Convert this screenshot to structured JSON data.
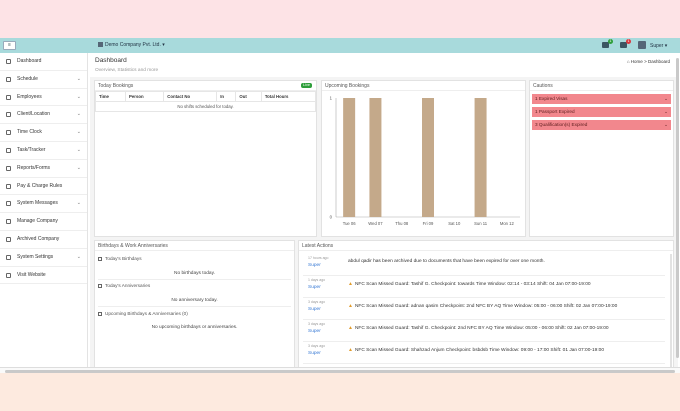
{
  "navbar": {
    "menu_label": "≡",
    "company": "Demo Company Pvt. Ltd.",
    "notif_count_1": "1",
    "notif_count_2": "1",
    "user": "Super"
  },
  "sidebar": {
    "items": [
      {
        "label": "Dashboard",
        "icon": "home-icon",
        "chevron": false
      },
      {
        "label": "Schedule",
        "icon": "calendar-icon",
        "chevron": true
      },
      {
        "label": "Employees",
        "icon": "users-icon",
        "chevron": true
      },
      {
        "label": "Client/Location",
        "icon": "location-icon",
        "chevron": true
      },
      {
        "label": "Time Clock",
        "icon": "clock-icon",
        "chevron": true
      },
      {
        "label": "Task/Tracker",
        "icon": "map-pin-icon",
        "chevron": true
      },
      {
        "label": "Reports/Forms",
        "icon": "file-icon",
        "chevron": true
      },
      {
        "label": "Pay & Charge Rules",
        "icon": "dollar-icon",
        "chevron": false
      },
      {
        "label": "System Messages",
        "icon": "envelope-icon",
        "chevron": true
      },
      {
        "label": "Manage Company",
        "icon": "building-icon",
        "chevron": false
      },
      {
        "label": "Archived Company",
        "icon": "archive-icon",
        "chevron": false
      },
      {
        "label": "System Settings",
        "icon": "gear-icon",
        "chevron": true
      },
      {
        "label": "Visit Website",
        "icon": "globe-icon",
        "chevron": false
      }
    ]
  },
  "page": {
    "title": "Dashboard",
    "subtitle": "Overview, Statistics and more",
    "breadcrumb_home": "Home",
    "breadcrumb_sep": ">",
    "breadcrumb_current": "Dashboard"
  },
  "today_bookings": {
    "title": "Today Bookings",
    "live": "Live",
    "columns": [
      "Time",
      "Person",
      "Contact No",
      "In",
      "Out",
      "Total Hours"
    ],
    "empty": "No shifts scheduled for today."
  },
  "upcoming": {
    "title": "Upcoming Bookings"
  },
  "chart_data": {
    "type": "bar",
    "categories": [
      "Tue 06",
      "Wed 07",
      "Thu 08",
      "Fri 09",
      "Sat 10",
      "Sun 11",
      "Mon 12"
    ],
    "values": [
      1,
      1,
      0,
      1,
      0,
      1,
      0
    ],
    "ylim": [
      0,
      1
    ],
    "yticks": [
      "0",
      "1"
    ],
    "bar_color": "#c4a98a",
    "grid": false,
    "legend": "none"
  },
  "cautions": {
    "title": "Cautions",
    "items": [
      "1 Expired Visas",
      "1 Passport Expired",
      "3 Qualification(s) Expired"
    ],
    "color": "#f2878d"
  },
  "birthdays": {
    "title": "Birthdays & Work Anniversaries",
    "today_birthdays": "Today's Birthdays",
    "no_birthdays": "No birthdays today.",
    "today_anniv": "Today's Anniversaries",
    "no_anniv": "No anniversary today.",
    "upcoming": "Upcoming Birthdays & Anniversaries (0)",
    "no_upcoming": "No upcoming birthdays or anniversaries."
  },
  "latest_actions": {
    "title": "Latest Actions",
    "items": [
      {
        "time": "17 hours ago",
        "user": "Super",
        "text": "abdul qadir has been archived due to documents that have been expired for over one month.",
        "warn": false
      },
      {
        "time": "1 days ago",
        "user": "Super",
        "text": "NFC Scan Missed Guard: Tashif G. Checkpoint: towards Time Window: 02:14 - 03:14 Shift: 04 Jan 07:00-19:00",
        "warn": true
      },
      {
        "time": "3 days ago",
        "user": "Super",
        "text": "NFC Scan Missed Guard: adnan qasim Checkpoint: 2nd NFC BY AQ Time Window: 05:00 - 06:00 Shift: 02 Jan 07:00-19:00",
        "warn": true
      },
      {
        "time": "3 days ago",
        "user": "Super",
        "text": "NFC Scan Missed Guard: Tashif G. Checkpoint: 2nd NFC BY AQ Time Window: 05:00 - 06:00 Shift: 02 Jan 07:00-19:00",
        "warn": true
      },
      {
        "time": "3 days ago",
        "user": "Super",
        "text": "NFC Scan Missed Guard: Shahzad Anjum Checkpoint: bsbdsb Time Window: 09:00 - 17:00 Shift: 01 Jan 07:00-19:00",
        "warn": true
      }
    ]
  }
}
